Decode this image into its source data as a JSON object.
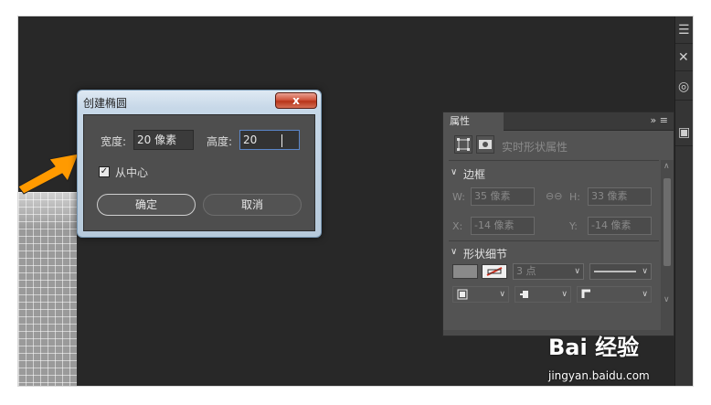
{
  "dialog": {
    "title": "创建椭圆",
    "close_glyph": "x",
    "width_label": "宽度:",
    "width_value": "20 像素",
    "height_label": "高度:",
    "height_value": "20",
    "center_checkbox_label": "从中心",
    "center_checked": true,
    "ok_label": "确定",
    "cancel_label": "取消"
  },
  "properties_panel": {
    "tab_label": "属性",
    "tab_icons": "»  ≡",
    "shape_type_label": "实时形状属性",
    "section_bounds": "边框",
    "w_label": "W:",
    "w_value": "35 像素",
    "h_label": "H:",
    "h_value": "33 像素",
    "x_label": "X:",
    "x_value": "-14 像素",
    "y_label": "Y:",
    "y_value": "-14 像素",
    "section_shape_details": "形状细节",
    "stroke_size": "3 点"
  },
  "watermark": {
    "logo_text": "Bai 经验",
    "url": "jingyan.baidu.com"
  },
  "colors": {
    "canvas": "#282828",
    "dialog_close": "#c8482d",
    "arrow_fill": "#ff9a00",
    "field_focus": "#5b86c9"
  }
}
